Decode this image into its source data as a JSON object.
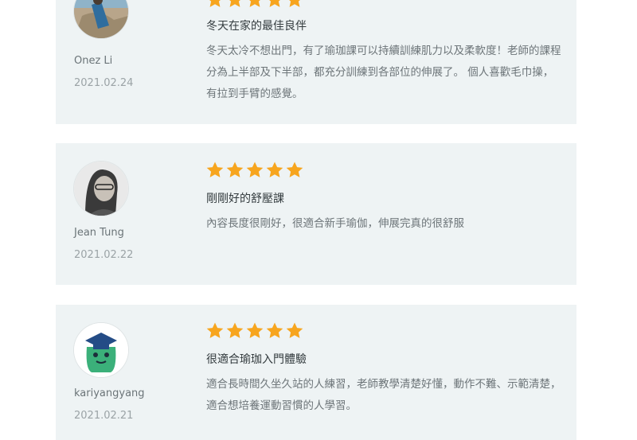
{
  "reviews": [
    {
      "title": "冬天在家的最佳良伴",
      "body": "冬天太冷不想出門，有了瑜珈課可以持續訓練肌力以及柔軟度！老師的課程分為上半部及下半部，都充分訓練到各部位的伸展了。 個人喜歡毛巾操，有拉到手臂的感覺。",
      "name": "Onez Li",
      "date": "2021.02.24",
      "rating": 5
    },
    {
      "title": "剛剛好的舒壓課",
      "body": "內容長度很剛好，很適合新手瑜伽，伸展完真的很舒服",
      "name": "Jean Tung",
      "date": "2021.02.22",
      "rating": 5
    },
    {
      "title": "很適合瑜珈入門體驗",
      "body": "適合長時間久坐久站的人練習，老師教學清楚好懂，動作不難、示範清楚，適合想培養運動習慣的人學習。",
      "name": "kariyangyang",
      "date": "2021.02.21",
      "rating": 5
    }
  ],
  "colors": {
    "star": "#f7a51e",
    "card_bg": "#eef3f4"
  }
}
